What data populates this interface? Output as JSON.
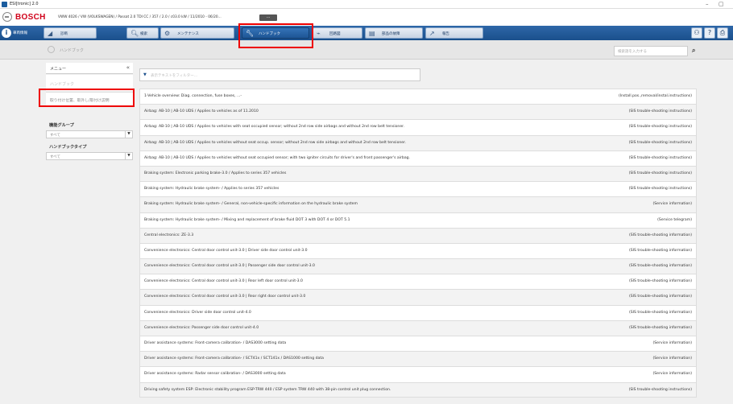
{
  "window": {
    "title": "ESI[tronic] 2.0",
    "minimize": "–",
    "maximize": "▢",
    "close": "✕"
  },
  "header": {
    "brand": "BOSCH",
    "vehicle": "VWW 4026 / VW (VOLKSWAGEN) / Passat 2.0 TDI CC / 357 / 2.0 / c03.0 kW / 11/2010 - 06/20...",
    "vehicle_button": "···"
  },
  "nav": {
    "vehicle_info": "車両情報",
    "tabs": [
      {
        "label": "診断",
        "icon": "car-diagnosis-icon"
      },
      {
        "label": "検索",
        "icon": "search-icon"
      },
      {
        "label": "メンテナンス",
        "icon": "gears-icon"
      },
      {
        "label": "ハンドブック",
        "icon": "wrench-icon"
      },
      {
        "label": "回路図",
        "icon": "circuit-diagram-icon"
      },
      {
        "label": "部品の故障",
        "icon": "parts-fault-icon"
      },
      {
        "label": "報告",
        "icon": "report-icon"
      }
    ],
    "right_buttons": [
      "user-icon",
      "help-icon",
      "print-icon"
    ]
  },
  "breadcrumb": {
    "label": "ハンドブック"
  },
  "search": {
    "placeholder": "検索語を入力する"
  },
  "sidebar": {
    "menu_title": "メニュー",
    "collapse": "«",
    "sub_title": "ハンドブック",
    "selected_item": "取り付け位置、取外し/取付け説明",
    "function_group_label": "機能グループ",
    "function_group_value": "すべて",
    "handbook_type_label": "ハンドブックタイプ",
    "handbook_type_value": "すべて"
  },
  "filter": {
    "placeholder": "表示テキストをフィルター..."
  },
  "rows": [
    {
      "title": "1-Vehicle overview: Diag. connection, fuse boxes, ...-",
      "type": "(Install.pos.,removal/instal.instructions)"
    },
    {
      "title": "Airbag: AB-10 | AB-10 UDS / Applies to vehicles as of 11.2010",
      "type": "(SIS trouble-shooting instructions)"
    },
    {
      "title": "Airbag: AB-10 | AB-10 UDS / Applies to vehicles with seat occupied sensor; without 2nd row side airbags and without 2nd row belt tensioner.",
      "type": "(SIS trouble-shooting instructions)"
    },
    {
      "title": "Airbag: AB-10 | AB-10 UDS / Applies to vehicles without seat occup. sensor; without 2nd row side airbags and without 2nd row belt tensioner.",
      "type": "(SIS trouble-shooting instructions)"
    },
    {
      "title": "Airbag: AB-10 | AB-10 UDS / Applies to vehicles without seat occupied sensor; with two igniter circuits for driver's and front passenger's airbag.",
      "type": "(SIS trouble-shooting instructions)"
    },
    {
      "title": "Braking system: Electronic parking brake-3.0 / Applies to series 357 vehicles",
      "type": "(SIS trouble-shooting instructions)"
    },
    {
      "title": "Braking system: Hydraulic brake system- / Applies to series 357 vehicles",
      "type": "(SIS trouble-shooting instructions)"
    },
    {
      "title": "Braking system: Hydraulic brake system- / General, non-vehicle-specific information on the hydraulic brake system",
      "type": "(Service information)"
    },
    {
      "title": "Braking system: Hydraulic brake system- / Mixing and replacement of brake fluid DOT 3 with DOT 4 or DOT 5.1",
      "type": "(Service telegram)"
    },
    {
      "title": "Central electronics: ZE-3.3",
      "type": "(SIS trouble-shooting information)"
    },
    {
      "title": "Convenience electronics: Central door control unit-3.0 | Driver side door control unit-3.0",
      "type": "(SIS trouble-shooting information)"
    },
    {
      "title": "Convenience electronics: Central door control unit-3.0 | Passenger side door control unit-3.0",
      "type": "(SIS trouble-shooting information)"
    },
    {
      "title": "Convenience electronics: Central door control unit-3.0 | Rear left door control unit-3.0",
      "type": "(SIS trouble-shooting information)"
    },
    {
      "title": "Convenience electronics: Central door control unit-3.0 | Rear right door control unit-3.0",
      "type": "(SIS trouble-shooting information)"
    },
    {
      "title": "Convenience electronics: Driver side door control unit-4.0",
      "type": "(SIS trouble-shooting information)"
    },
    {
      "title": "Convenience electronics: Passenger side door control unit-4.0",
      "type": "(SIS trouble-shooting information)"
    },
    {
      "title": "Driver assistance systems: Front-camera calibration- / DAS3000 setting data",
      "type": "(Service information)"
    },
    {
      "title": "Driver assistance systems: Front-camera calibration- / SCT41x / SCT141x / DAS1000 setting data",
      "type": "(Service information)"
    },
    {
      "title": "Driver assistance systems: Radar sensor calibration- / DAS3000 setting data",
      "type": "(Service information)"
    },
    {
      "title": "Driving safety system ESP: Electronic stability program ESP-TRW 440 / ESP system TRW 440 with 38-pin control unit plug connection.",
      "type": "(SIS trouble-shooting instructions)"
    }
  ]
}
